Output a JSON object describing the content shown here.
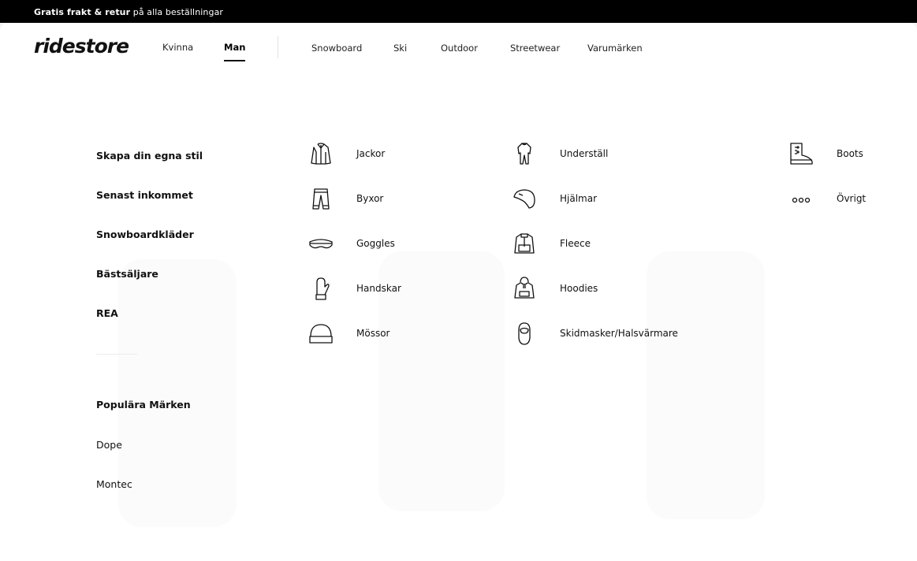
{
  "topbar": {
    "bold": "Gratis frakt & retur",
    "rest": " på alla beställningar"
  },
  "logo": "ridestore",
  "genders": [
    {
      "label": "Kvinna"
    },
    {
      "label": "Man"
    }
  ],
  "categories_nav": [
    {
      "label": "Snowboard"
    },
    {
      "label": "Ski"
    },
    {
      "label": "Outdoor"
    },
    {
      "label": "Streetwear"
    },
    {
      "label": "Varumärken"
    }
  ],
  "left_links": [
    {
      "label": "Skapa din egna stil"
    },
    {
      "label": "Senast inkommet"
    },
    {
      "label": "Snowboardkläder"
    },
    {
      "label": "Bästsäljare"
    },
    {
      "label": "REA"
    }
  ],
  "brands": {
    "heading": "Populära Märken",
    "items": [
      {
        "label": "Dope"
      },
      {
        "label": "Montec"
      }
    ]
  },
  "product_columns": [
    [
      {
        "label": "Jackor",
        "icon": "jacket-icon"
      },
      {
        "label": "Byxor",
        "icon": "pants-icon"
      },
      {
        "label": "Goggles",
        "icon": "goggles-icon"
      },
      {
        "label": "Handskar",
        "icon": "mitten-icon"
      },
      {
        "label": "Mössor",
        "icon": "beanie-icon"
      }
    ],
    [
      {
        "label": "Underställ",
        "icon": "baselayer-icon"
      },
      {
        "label": "Hjälmar",
        "icon": "helmet-icon"
      },
      {
        "label": "Fleece",
        "icon": "fleece-icon"
      },
      {
        "label": "Hoodies",
        "icon": "hoodie-icon"
      },
      {
        "label": "Skidmasker/Halsvärmare",
        "icon": "balaclava-icon"
      }
    ],
    [
      {
        "label": "Boots",
        "icon": "boot-icon"
      },
      {
        "label": "Övrigt",
        "icon": "more-dots-icon"
      }
    ]
  ]
}
